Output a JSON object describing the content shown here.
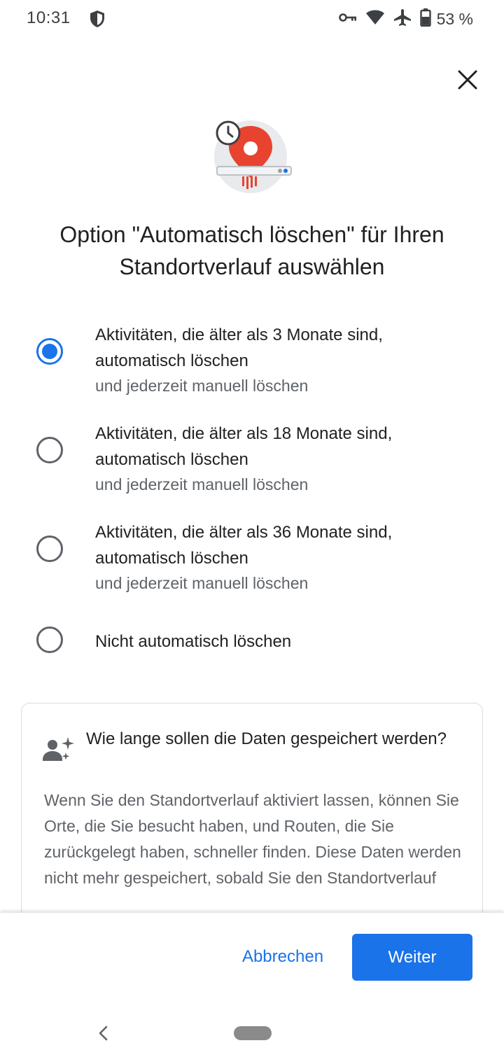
{
  "status_bar": {
    "time": "10:31",
    "battery_text": "53 %",
    "icons": [
      "shield-icon",
      "vpn-key-icon",
      "wifi-icon",
      "airplane-icon",
      "battery-icon"
    ]
  },
  "dialog": {
    "close_icon": "close-icon",
    "hero_icon": "location-history-autodelete-illustration",
    "title": "Option \"Automatisch löschen\" für Ihren Standortverlauf auswählen"
  },
  "options": [
    {
      "label": "Aktivitäten, die älter als 3 Monate sind, automatisch löschen",
      "sublabel": "und jederzeit manuell löschen",
      "selected": true
    },
    {
      "label": "Aktivitäten, die älter als 18 Monate sind, automatisch löschen",
      "sublabel": "und jederzeit manuell löschen",
      "selected": false
    },
    {
      "label": "Aktivitäten, die älter als 36 Monate sind, automatisch löschen",
      "sublabel": "und jederzeit manuell löschen",
      "selected": false
    },
    {
      "label": "Nicht automatisch löschen",
      "sublabel": "",
      "selected": false
    }
  ],
  "info_card": {
    "icon": "person-sparkle-icon",
    "title": "Wie lange sollen die Daten gespeichert werden?",
    "body": "Wenn Sie den Standortverlauf aktiviert lassen, können Sie Orte, die Sie besucht haben, und Routen, die Sie zurückgelegt haben, schneller finden. Diese Daten werden nicht mehr gespeichert, sobald Sie den Standortverlauf"
  },
  "footer": {
    "cancel_label": "Abbrechen",
    "next_label": "Weiter"
  },
  "colors": {
    "accent": "#1a73e8",
    "primary_text": "#202124",
    "secondary_text": "#5f6368",
    "hero_red": "#e8432e"
  }
}
